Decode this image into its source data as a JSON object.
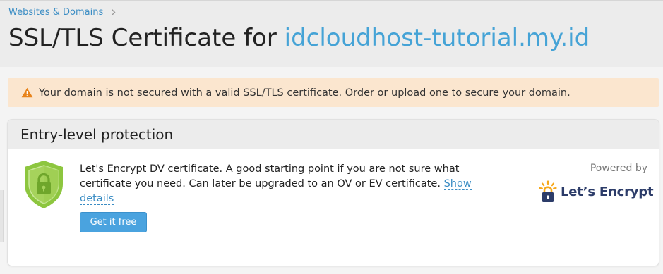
{
  "breadcrumb": {
    "label": "Websites & Domains"
  },
  "page": {
    "title_prefix": "SSL/TLS Certificate for ",
    "title_domain": "idcloudhost-tutorial.my.id"
  },
  "alert": {
    "icon": "warning-icon",
    "message": "Your domain is not secured with a valid SSL/TLS certificate. Order or upload one to secure your domain."
  },
  "entry_card": {
    "title": "Entry-level protection",
    "description": "Let's Encrypt DV certificate. A good starting point if you are not sure what certificate you need. Can later be upgraded to an OV or EV certificate.",
    "show_details_link": "Show details",
    "button_label": "Get it free",
    "powered_by": "Powered by",
    "provider_logo_text": "Let’s Encrypt",
    "shield_icon": "shield-lock-icon"
  },
  "colors": {
    "link": "#3b8dc4",
    "domain_title": "#45a3d6",
    "alert_bg": "#fbe6cf",
    "alert_icon": "#e8831b",
    "button_bg": "#4aa3df",
    "shield_green": "#8dc63f",
    "logo_navy": "#2c3c69",
    "logo_orange": "#f7a81b"
  }
}
